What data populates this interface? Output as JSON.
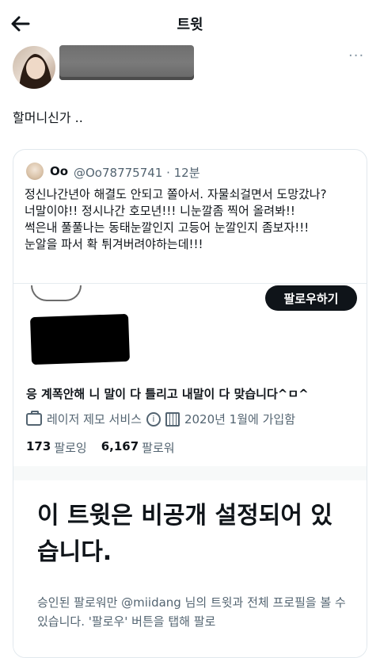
{
  "header": {
    "title": "트윗"
  },
  "tweet": {
    "text": "할머니신가 .."
  },
  "quote": {
    "name": "Oo",
    "handle_time": "@Oo78775741 · 12분",
    "text": "정신나간년아 해결도 안되고 쫄아서. 자물쇠걸면서 도망갔나?\n 너말이야!!  정시나간 호모년!!!  니눈깔좀 찍어 올려봐!!\n썩은내 풀풀나는 동태눈깔인지 고등어 눈깔인지 좀보자!!!\n눈알을 파서 확 튀겨버려야하는데!!!"
  },
  "profile": {
    "follow_label": "팔로우하기",
    "bio": "응 계폭안해 니 말이 다 틀리고 내말이 다 맞습니다^ㅁ^",
    "job": "레이저 제모 서비스",
    "joined": "2020년 1월에 가입함",
    "following_count": "173",
    "following_label": "팔로잉",
    "followers_count": "6,167",
    "followers_label": "팔로워"
  },
  "privacy": {
    "title": "이 트윗은 비공개 설정되어 있습니다.",
    "desc": "승인된 팔로워만 @miidang 님의 트윗과 전체 프로필을 볼 수 있습니다. '팔로우' 버튼을 탭해 팔로"
  },
  "icons": [
    "back-arrow-icon",
    "more-icon",
    "briefcase-icon",
    "info-icon",
    "calendar-icon"
  ]
}
